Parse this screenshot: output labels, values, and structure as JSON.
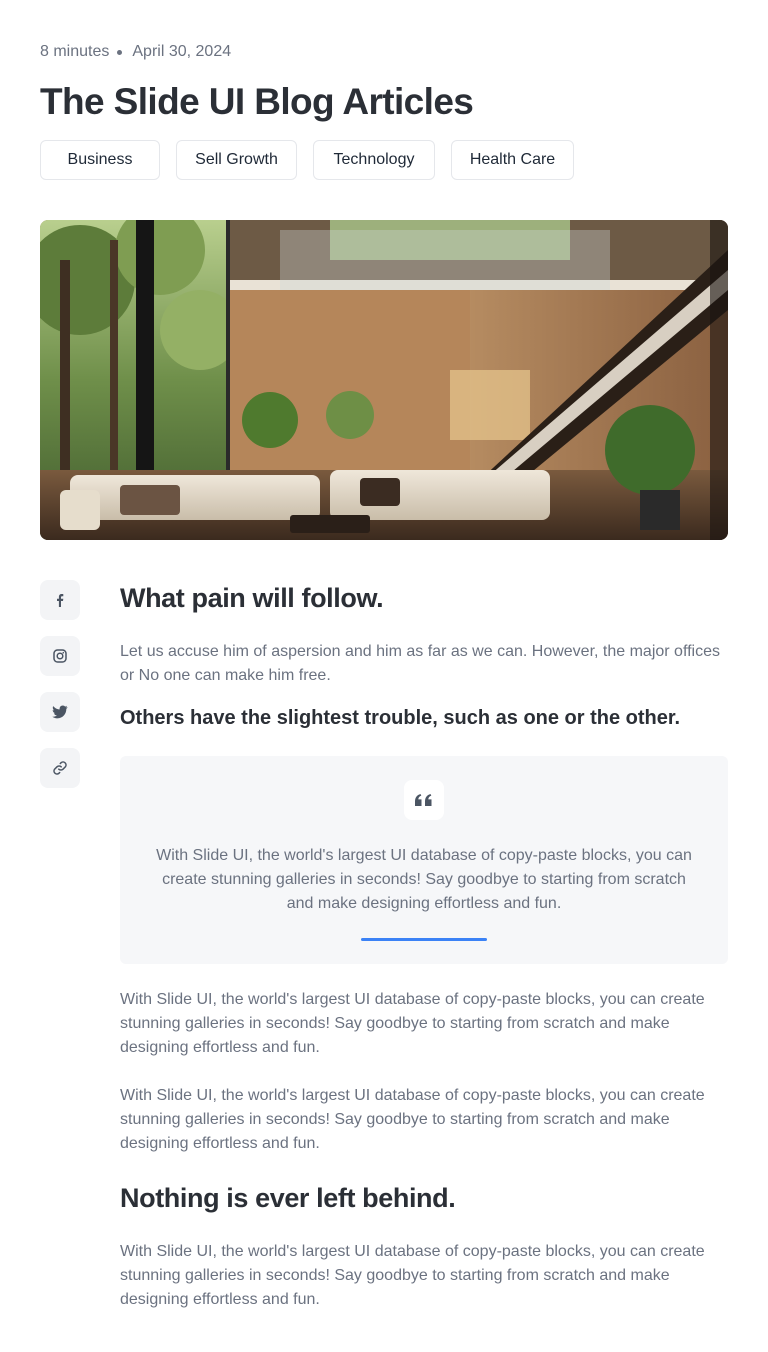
{
  "meta": {
    "read_time": "8 minutes",
    "date": "April 30, 2024"
  },
  "title": "The Slide UI Blog Articles",
  "tags": [
    "Business",
    "Sell Growth",
    "Technology",
    "Health Care"
  ],
  "social": [
    "facebook-icon",
    "instagram-icon",
    "twitter-icon",
    "link-icon"
  ],
  "article": {
    "heading1": "What pain will follow.",
    "para1": "Let us accuse him of aspersion and him as far as we can. However, the major offices or No one can make him free.",
    "subheading": "Others have the slightest trouble, such as one or the other.",
    "quote": "With Slide UI, the world's largest UI database of copy-paste blocks, you can create stunning galleries in seconds! Say goodbye to starting from scratch and make designing effortless and fun.",
    "para2": "With Slide UI, the world's largest UI database of copy-paste blocks, you can create stunning galleries in seconds! Say goodbye to starting from scratch and make designing effortless and fun.",
    "para3": "With Slide UI, the world's largest UI database of copy-paste blocks, you can create stunning galleries in seconds! Say goodbye to starting from scratch and make designing effortless and fun.",
    "heading2": "Nothing is ever left behind.",
    "para4": "With Slide UI, the world's largest UI database of copy-paste blocks, you can create stunning galleries in seconds! Say goodbye to starting from scratch and make designing effortless and fun."
  },
  "colors": {
    "accent": "#3b82f6",
    "muted_text": "#6b7280",
    "heading": "#2b2f36",
    "panel": "#f6f7f9"
  }
}
